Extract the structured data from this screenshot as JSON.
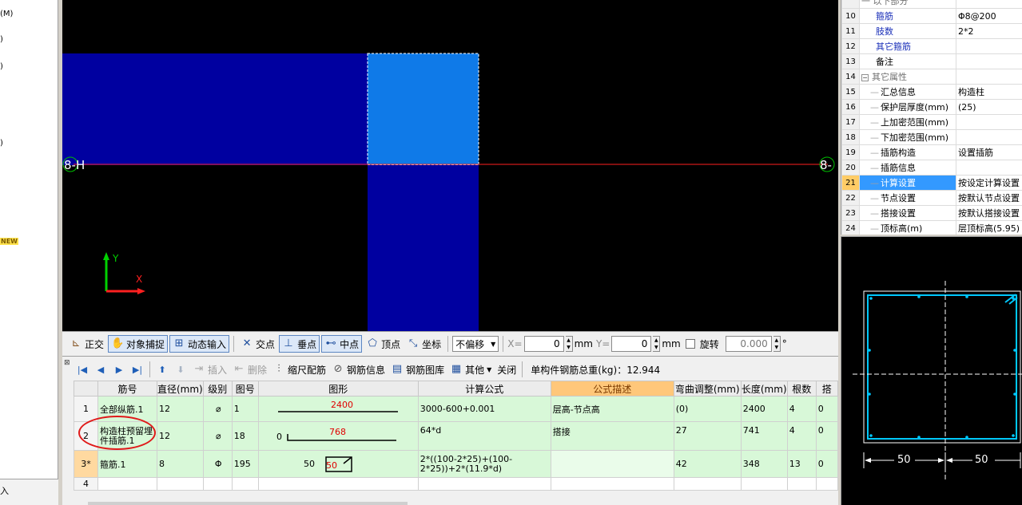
{
  "left_panel": {
    "fragments": [
      "(M)",
      ")",
      ")",
      ")"
    ],
    "new_badge": "NEW",
    "bottom_text": "入"
  },
  "canvas": {
    "axis_left": "8-H",
    "axis_right": "8-",
    "y_label": "Y",
    "x_label": "X",
    "colors": {
      "column_dark": "#0000a0",
      "column_selected": "#0f7ae8",
      "axis_line": "#ff2020",
      "background": "#000000"
    }
  },
  "snap_toolbar": {
    "ortho": "正交",
    "object_snap": "对象捕捉",
    "dynamic_input": "动态输入",
    "intersection": "交点",
    "perpendicular": "垂点",
    "midpoint": "中点",
    "vertex": "顶点",
    "coordinate": "坐标",
    "offset_mode": "不偏移",
    "x_label": "X=",
    "x_value": "0",
    "x_unit": "mm",
    "y_label": "Y=",
    "y_value": "0",
    "y_unit": "mm",
    "rotate_label": "旋转",
    "rotate_value": "0.000",
    "degree": "°"
  },
  "rebar_toolbar": {
    "insert": "插入",
    "delete": "删除",
    "scale_rebar": "缩尺配筋",
    "rebar_info": "钢筋信息",
    "rebar_library": "钢筋图库",
    "other": "其他",
    "close": "关闭",
    "total_weight_label": "单构件钢筋总重(kg)：12.944"
  },
  "rebar_table": {
    "headers": [
      "",
      "筋号",
      "直径(mm)",
      "级别",
      "图号",
      "图形",
      "计算公式",
      "公式描述",
      "弯曲调整(mm)",
      "长度(mm)",
      "根数",
      "搭"
    ],
    "rows": [
      {
        "num": "1",
        "name": "全部纵筋.1",
        "dia": "12",
        "grade": "⌀",
        "fig": "1",
        "shape_left": "",
        "shape_value": "2400",
        "formula": "3000-600+0.001",
        "desc": "层高-节点高",
        "bend": "(0)",
        "length": "2400",
        "count": "4",
        "lap": "0"
      },
      {
        "num": "2",
        "name": "构造柱预留埋件插筋.1",
        "dia": "12",
        "grade": "⌀",
        "fig": "18",
        "shape_left": "0",
        "shape_value": "768",
        "formula": "64*d",
        "desc": "搭接",
        "bend": "27",
        "length": "741",
        "count": "4",
        "lap": "0"
      },
      {
        "num": "3*",
        "name": "箍筋.1",
        "dia": "8",
        "grade": "Φ",
        "fig": "195",
        "shape_left": "50",
        "shape_value": "50",
        "formula": "2*((100-2*25)+(100-2*25))+2*(11.9*d)",
        "desc": "",
        "bend": "42",
        "length": "348",
        "count": "13",
        "lap": "0"
      },
      {
        "num": "4"
      }
    ]
  },
  "properties": {
    "rows": [
      {
        "num": "",
        "name": "一 以下部分",
        "value": "",
        "style": "grey"
      },
      {
        "num": "10",
        "name": "箍筋",
        "value": "Φ8@200",
        "style": "blue"
      },
      {
        "num": "11",
        "name": "肢数",
        "value": "2*2",
        "style": "blue"
      },
      {
        "num": "12",
        "name": "其它箍筋",
        "value": "",
        "style": "blue"
      },
      {
        "num": "13",
        "name": "备注",
        "value": "",
        "style": "normal"
      },
      {
        "num": "14",
        "name": "其它属性",
        "value": "",
        "style": "grey",
        "expander": "−"
      },
      {
        "num": "15",
        "name": "汇总信息",
        "value": "构造柱",
        "style": "tree"
      },
      {
        "num": "16",
        "name": "保护层厚度(mm)",
        "value": "(25)",
        "style": "tree"
      },
      {
        "num": "17",
        "name": "上加密范围(mm)",
        "value": "",
        "style": "tree"
      },
      {
        "num": "18",
        "name": "下加密范围(mm)",
        "value": "",
        "style": "tree"
      },
      {
        "num": "19",
        "name": "插筋构造",
        "value": "设置插筋",
        "style": "tree"
      },
      {
        "num": "20",
        "name": "插筋信息",
        "value": "",
        "style": "tree"
      },
      {
        "num": "21",
        "name": "计算设置",
        "value": "按设定计算设置",
        "style": "tree",
        "selected": true
      },
      {
        "num": "22",
        "name": "节点设置",
        "value": "按默认节点设置",
        "style": "tree"
      },
      {
        "num": "23",
        "name": "搭接设置",
        "value": "按默认搭接设置",
        "style": "tree"
      },
      {
        "num": "24",
        "name": "顶标高(m)",
        "value": "层顶标高(5.95)",
        "style": "tree"
      }
    ]
  },
  "section_preview": {
    "dim_left": "50",
    "dim_right": "50",
    "colors": {
      "stirrup": "#00c8ff",
      "outline": "#ffffff"
    }
  }
}
